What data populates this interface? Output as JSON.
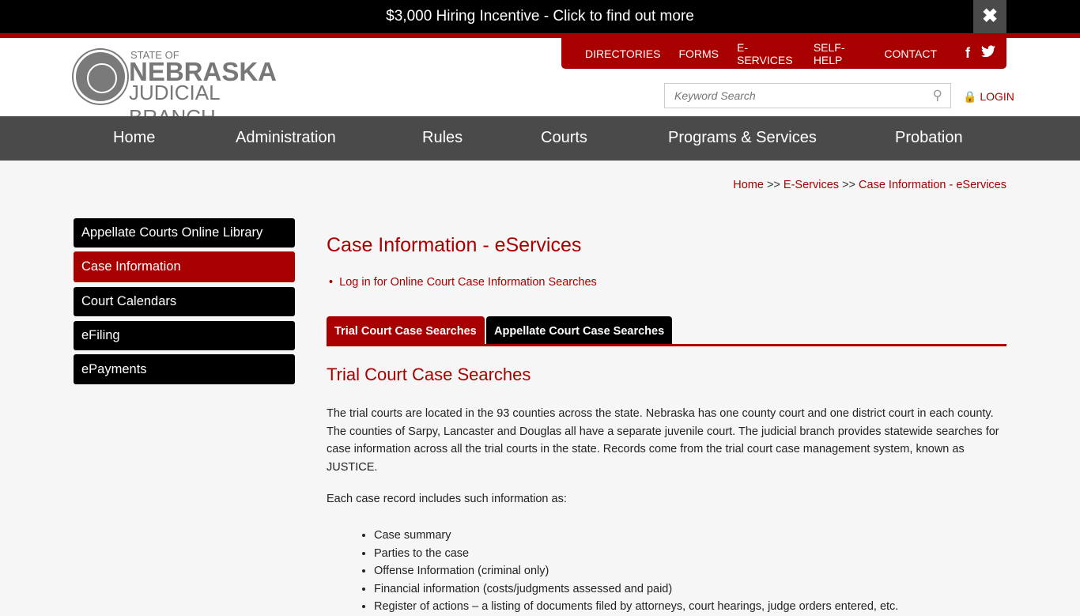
{
  "banner": {
    "text": "$3,000 Hiring Incentive - Click to find out more",
    "close_icon": "close-icon"
  },
  "logo": {
    "line1": "STATE OF",
    "line2": "NEBRASKA",
    "line3": "JUDICIAL BRANCH"
  },
  "utility_nav": [
    "DIRECTORIES",
    "FORMS",
    "E-SERVICES",
    "SELF-HELP",
    "CONTACT"
  ],
  "social": {
    "facebook": "f",
    "twitter": "t"
  },
  "search": {
    "placeholder": "Keyword Search"
  },
  "login": "LOGIN",
  "main_nav": [
    "Home",
    "Administration",
    "Rules",
    "Courts",
    "Programs & Services",
    "Probation"
  ],
  "breadcrumb": [
    "Home",
    "E-Services",
    "Case Information - eServices"
  ],
  "breadcrumb_sep": ">>",
  "sidebar": [
    "Appellate Courts Online Library",
    "Case Information",
    "Court Calendars",
    "eFiling",
    "ePayments"
  ],
  "page_title": "Case Information - eServices",
  "top_link": "Log in for Online Court Case Information Searches",
  "tabs": [
    "Trial Court Case Searches",
    "Appellate Court Case Searches"
  ],
  "section_title": "Trial Court Case Searches",
  "paragraph1": "The trial courts are located in the 93 counties across the state.  Nebraska has one county court and one district court in each county.  The counties of Sarpy, Lancaster and Douglas all have a separate juvenile court.  The judicial branch provides statewide searches for case information across all the trial courts in the state.  Records come from the trial court case management system, known as JUSTICE.",
  "paragraph2": "Each case record includes such information as:",
  "list": [
    "Case summary",
    "Parties to the case",
    "Offense Information (criminal only)",
    "Financial information (costs/judgments assessed and paid)",
    "Register of actions – a listing of documents filed by attorneys, court hearings, judge orders entered, etc."
  ],
  "colors": {
    "brand_red": "#a80000",
    "nav_gray": "#4a4a4a"
  }
}
